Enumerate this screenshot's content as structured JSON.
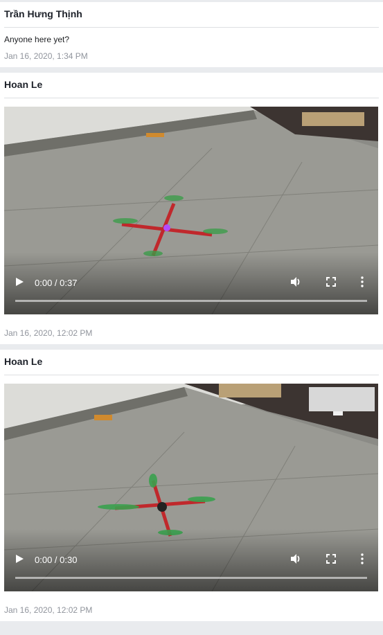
{
  "posts": [
    {
      "author": "Trần Hưng Thịnh",
      "text": "Anyone here yet?",
      "timestamp": "Jan 16, 2020, 1:34 PM"
    },
    {
      "author": "Hoan Le",
      "video": {
        "time_display": "0:00 / 0:37"
      },
      "timestamp": "Jan 16, 2020, 12:02 PM"
    },
    {
      "author": "Hoan Le",
      "video": {
        "time_display": "0:00 / 0:30"
      },
      "timestamp": "Jan 16, 2020, 12:02 PM"
    }
  ],
  "icons": {
    "play": "play-icon",
    "volume": "volume-icon",
    "fullscreen": "fullscreen-icon",
    "more": "more-options-icon"
  },
  "colors": {
    "background": "#e9ebee",
    "card": "#ffffff",
    "timestamp": "#90949c",
    "author": "#1d2129"
  }
}
